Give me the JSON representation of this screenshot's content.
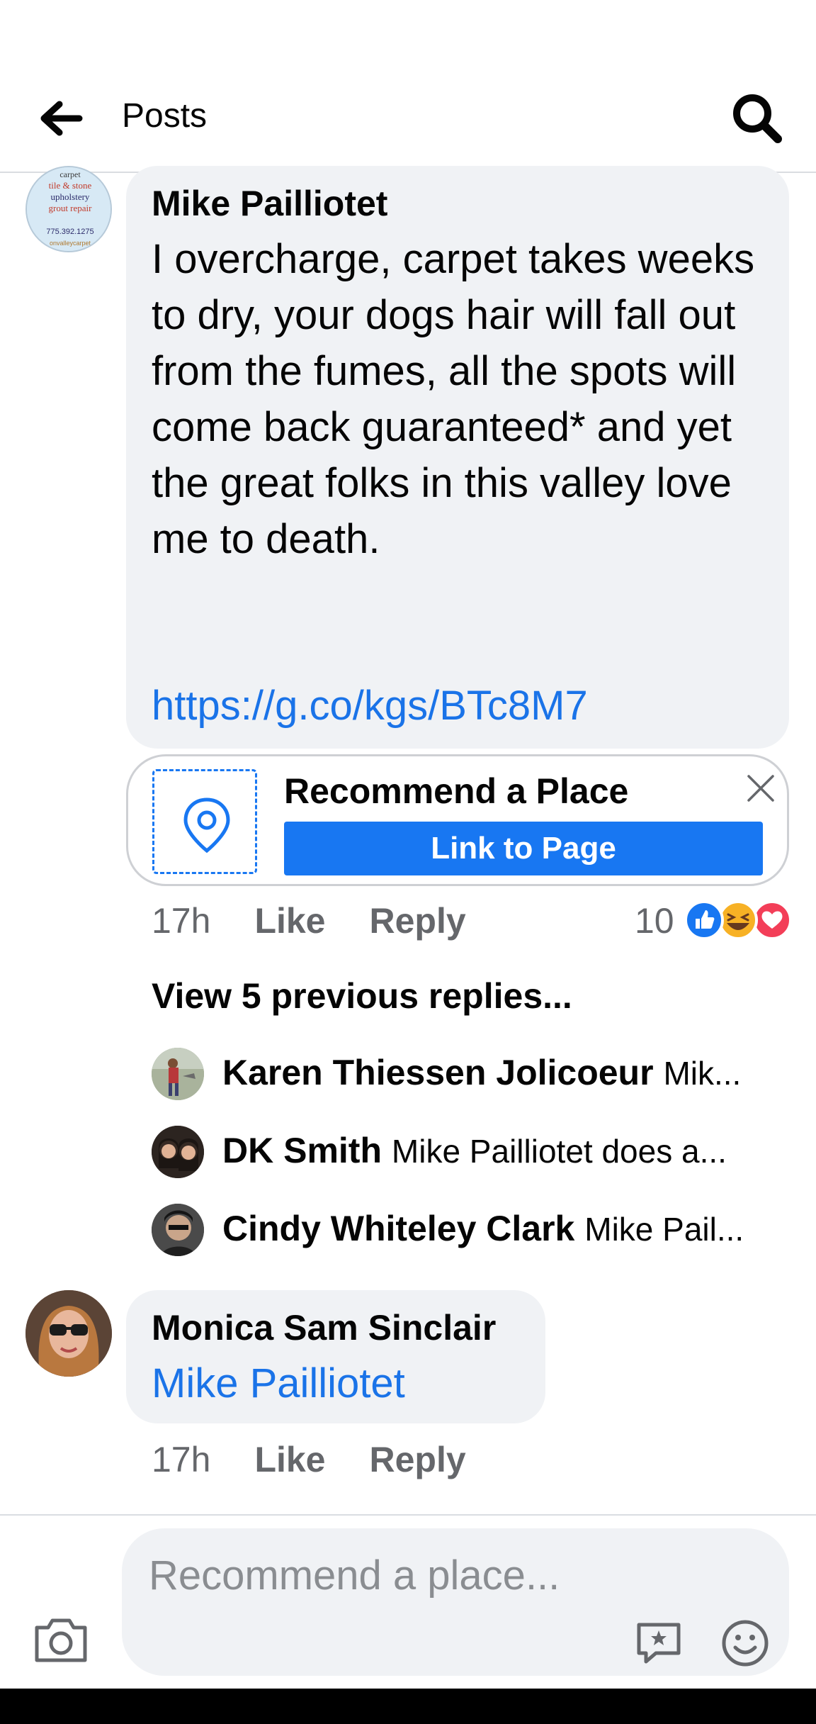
{
  "header": {
    "title": "Posts",
    "back_icon": "arrow-left-icon",
    "search_icon": "search-icon"
  },
  "main_comment": {
    "author": "Mike Pailliotet",
    "avatar_text": [
      "carpet",
      "tile & stone",
      "upholstery",
      "grout repair",
      "775.392.1275",
      "...onvalleycarpet..."
    ],
    "text": "I overcharge, carpet takes weeks to dry, your dogs hair will fall out from the fumes, all the spots will come back guaranteed* and yet the great folks in this valley love me to death.",
    "link": "https://g.co/kgs/BTc8M7",
    "recommend": {
      "title": "Recommend a Place",
      "button": "Link to Page",
      "icon": "map-pin-icon",
      "close_icon": "close-icon"
    },
    "time": "17h",
    "like": "Like",
    "reply": "Reply",
    "reaction_count": "10",
    "reactions": [
      "like",
      "haha",
      "love"
    ]
  },
  "view_previous": "View 5 previous replies...",
  "replies": [
    {
      "name": "Karen Thiessen Jolicoeur",
      "snippet": "Mik..."
    },
    {
      "name": "DK Smith",
      "snippet": "Mike Pailliotet  does a..."
    },
    {
      "name": "Cindy Whiteley Clark",
      "snippet": "Mike Pail..."
    }
  ],
  "second_comment": {
    "author": "Monica Sam Sinclair",
    "mention": "Mike Pailliotet",
    "time": "17h",
    "like": "Like",
    "reply": "Reply"
  },
  "composer": {
    "placeholder": "Recommend a place...",
    "camera_icon": "camera-icon",
    "sticker_icon": "sticker-icon",
    "emoji_icon": "emoji-icon"
  },
  "colors": {
    "accent": "#1877f2",
    "link": "#1a73e8",
    "bubble": "#f0f2f5",
    "muted": "#65676b"
  }
}
